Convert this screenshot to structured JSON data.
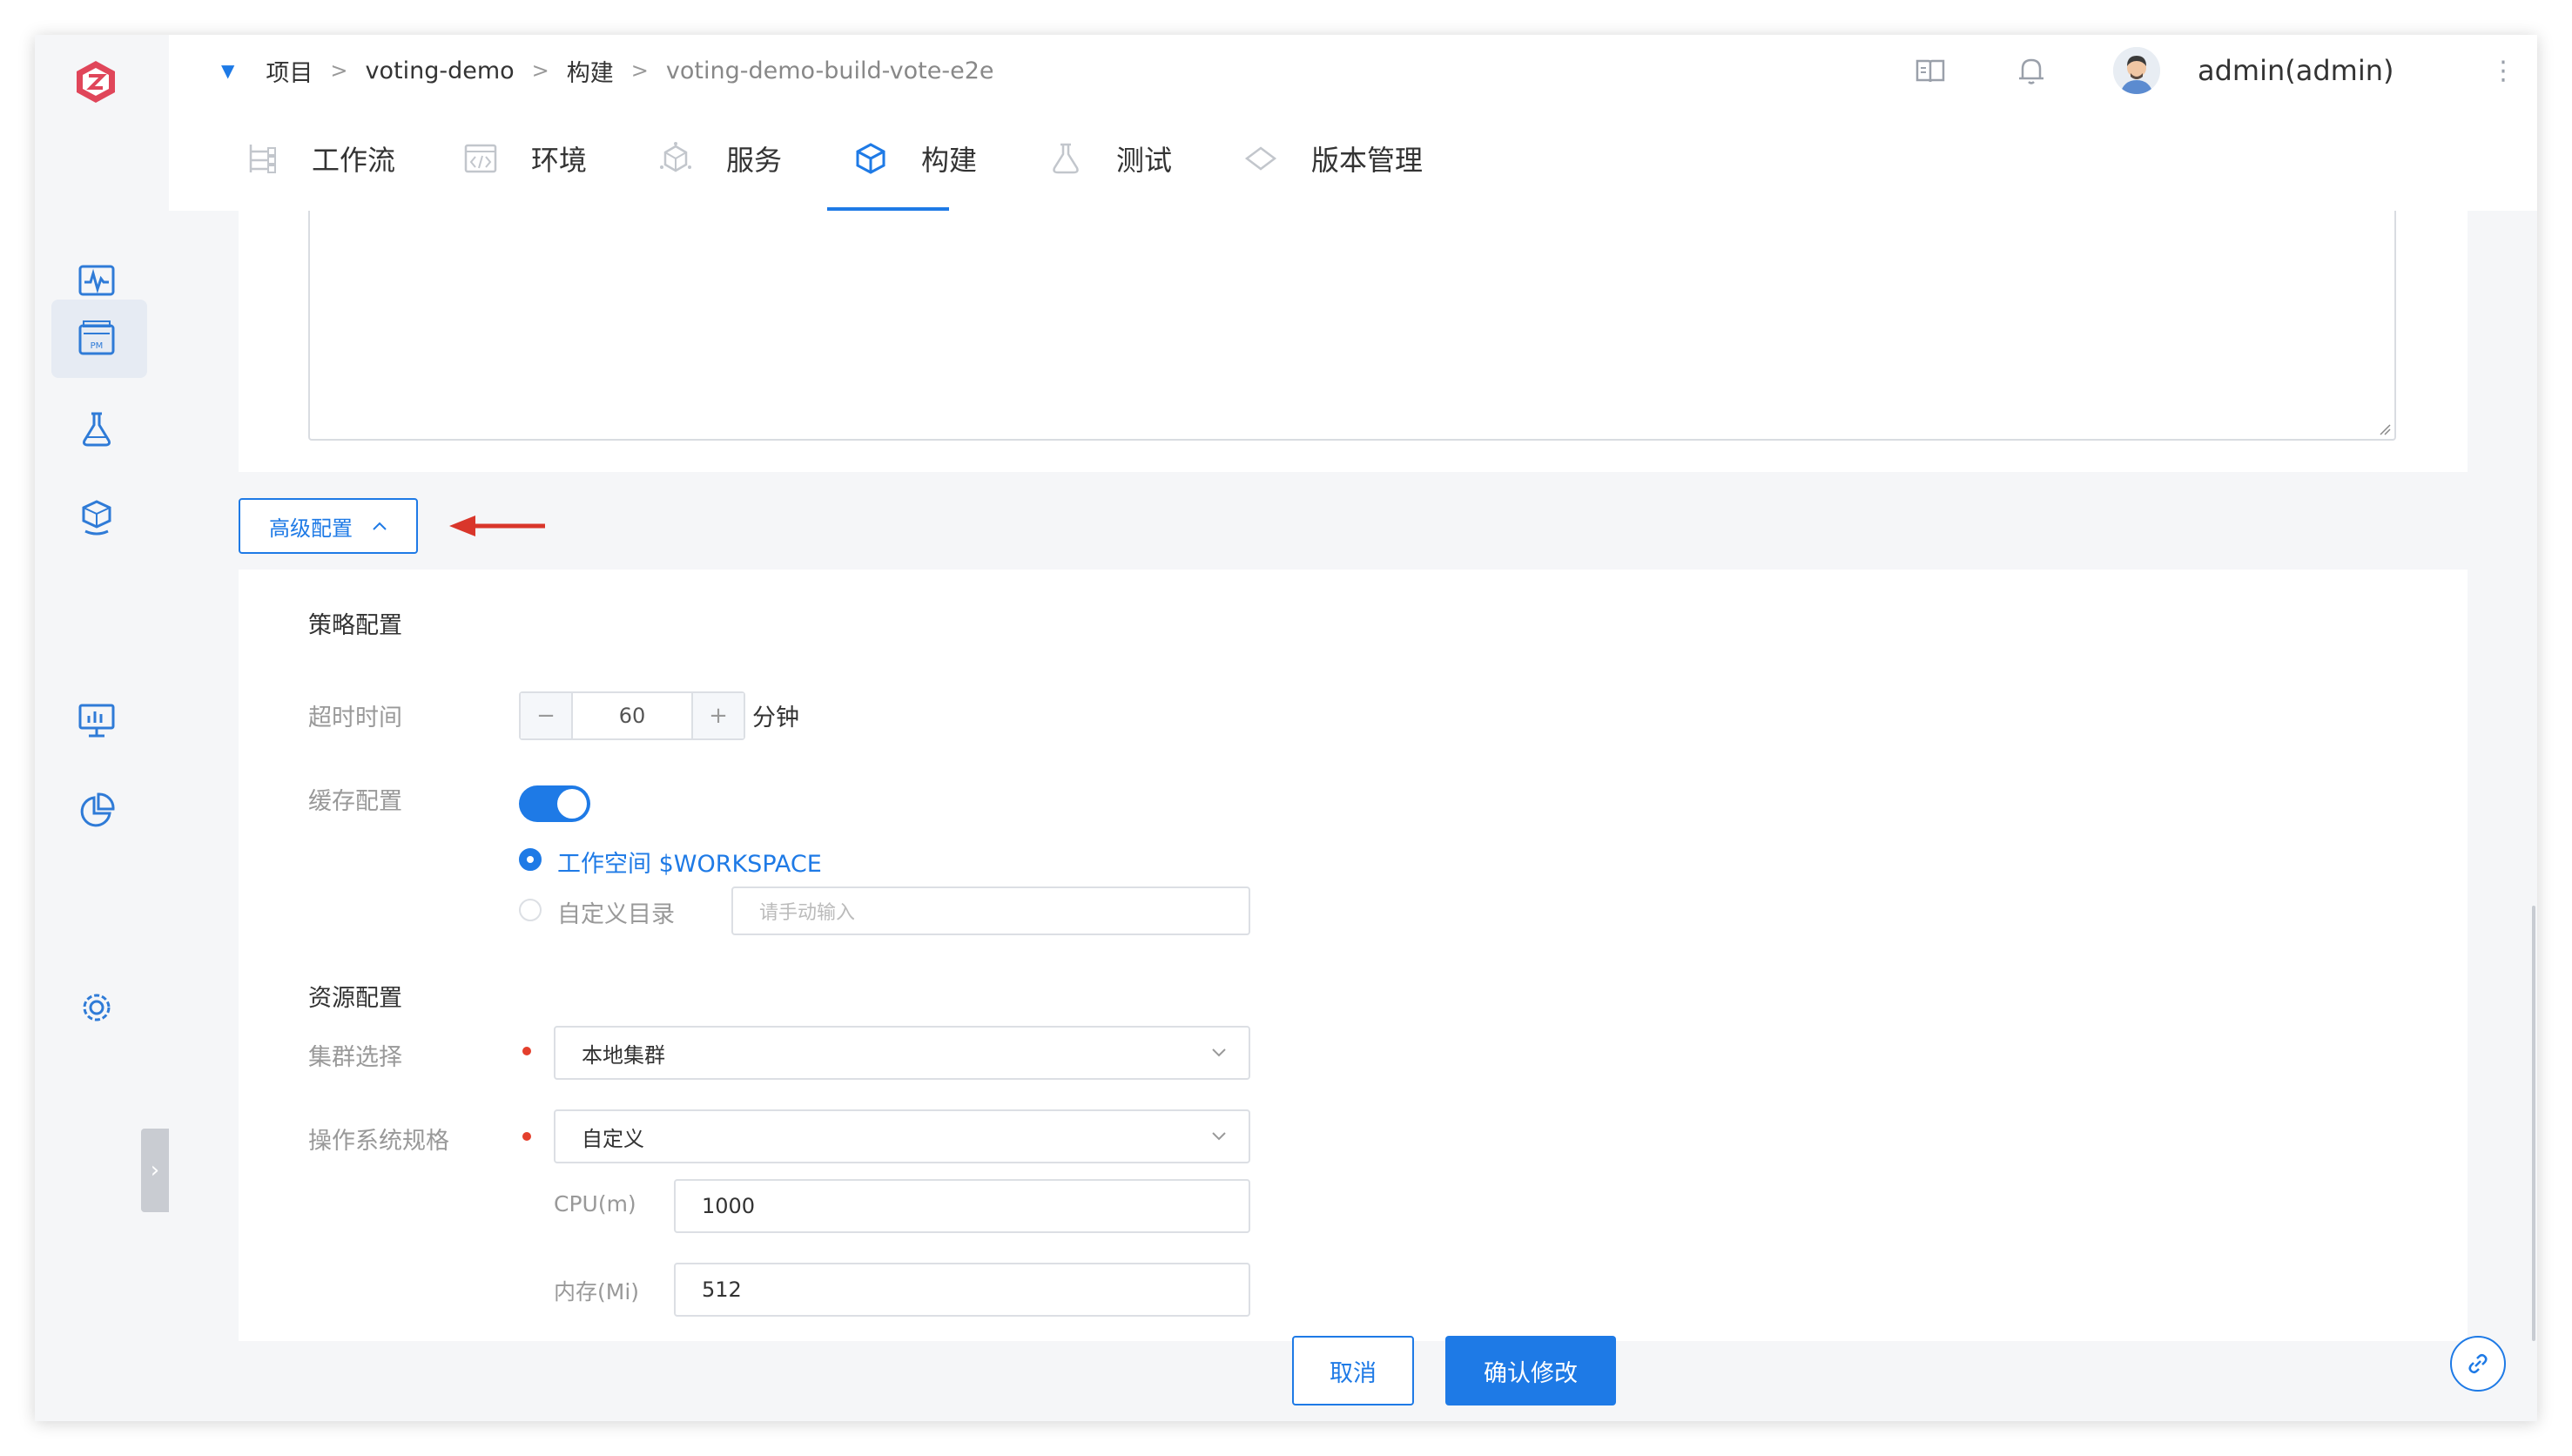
{
  "breadcrumb": {
    "items": [
      "项目",
      "voting-demo",
      "构建",
      "voting-demo-build-vote-e2e"
    ],
    "separator": ">"
  },
  "header": {
    "user": "admin(admin)",
    "icons": [
      "book-icon",
      "bell-icon",
      "avatar",
      "kebab-menu-icon"
    ]
  },
  "sidebar": {
    "icons": [
      "logo",
      "monitor-wave-icon",
      "project-pm-icon",
      "flask-icon",
      "box-hand-icon",
      "dashboard-chart-icon",
      "pie-chart-icon",
      "settings-gear-icon"
    ],
    "active": "project-pm-icon"
  },
  "tabs": [
    {
      "label": "工作流",
      "icon": "workflow-icon"
    },
    {
      "label": "环境",
      "icon": "code-window-icon"
    },
    {
      "label": "服务",
      "icon": "service-cube-icon"
    },
    {
      "label": "构建",
      "icon": "build-box-icon",
      "active": true
    },
    {
      "label": "测试",
      "icon": "flask-icon"
    },
    {
      "label": "版本管理",
      "icon": "diamond-icon"
    }
  ],
  "advanced": {
    "toggle_label": "高级配置"
  },
  "strategy": {
    "title": "策略配置",
    "timeout_label": "超时时间",
    "timeout_value": "60",
    "timeout_unit": "分钟",
    "minus": "−",
    "plus": "+",
    "cache_label": "缓存配置",
    "cache_enabled": true,
    "workspace_option": "工作空间 $WORKSPACE",
    "custom_dir_option": "自定义目录",
    "custom_dir_placeholder": "请手动输入"
  },
  "resource": {
    "title": "资源配置",
    "cluster_label": "集群选择",
    "cluster_value": "本地集群",
    "os_spec_label": "操作系统规格",
    "os_spec_value": "自定义",
    "cpu_label": "CPU(m)",
    "cpu_value": "1000",
    "mem_label": "内存(Mi)",
    "mem_value": "512"
  },
  "footer": {
    "cancel": "取消",
    "confirm": "确认修改"
  },
  "colors": {
    "accent": "#1e7ae6",
    "required": "#e43f2c",
    "arrow": "#d9362b"
  }
}
